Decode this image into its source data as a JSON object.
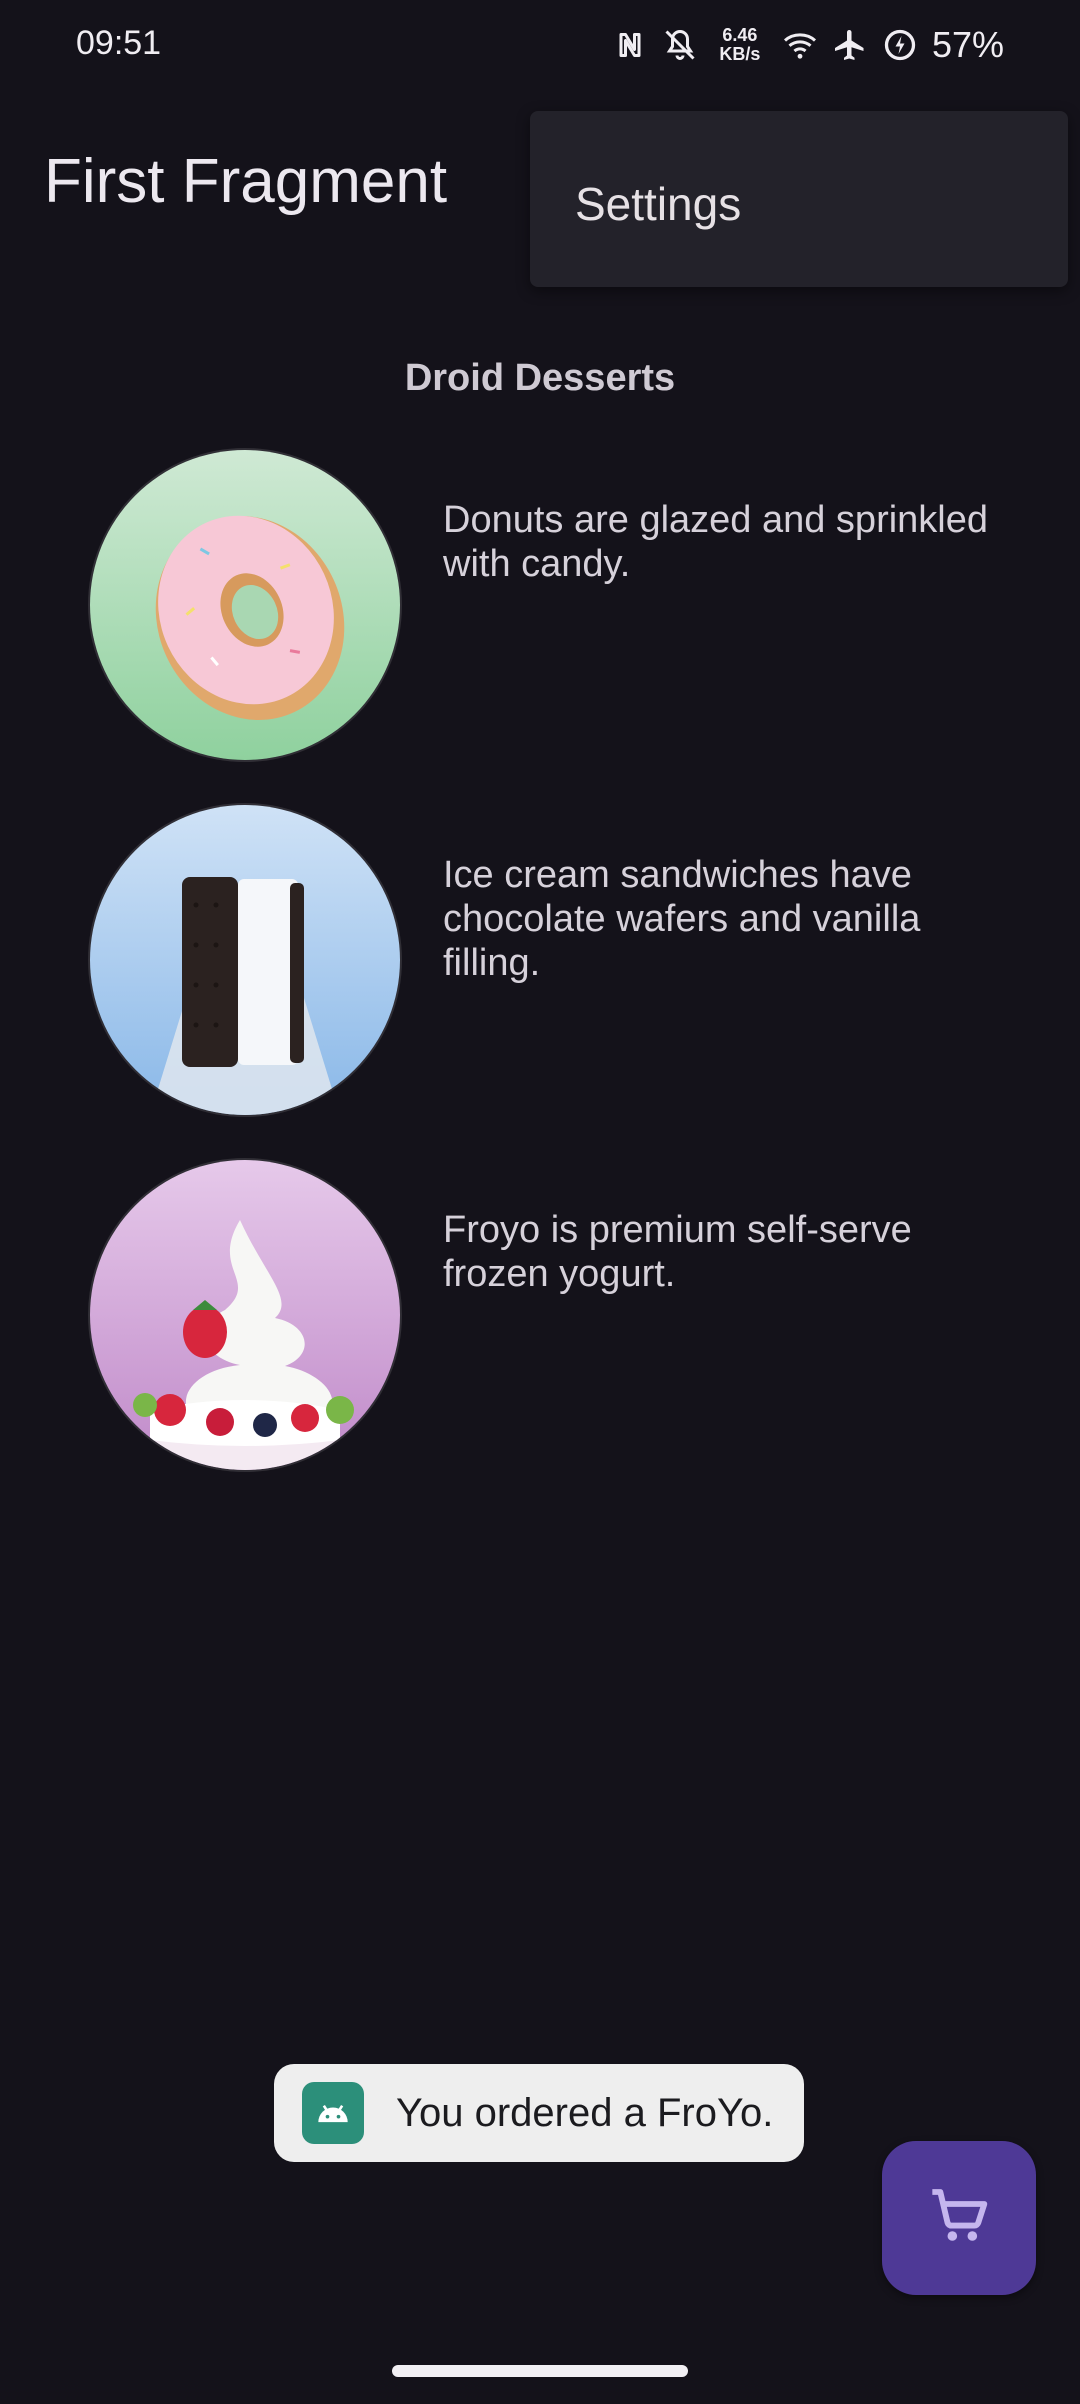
{
  "status_bar": {
    "time": "09:51",
    "net_speed_value": "6.46",
    "net_speed_unit": "KB/s",
    "battery_percent": "57%",
    "icons": [
      "nfc-icon",
      "bell-off-icon",
      "wifi-icon",
      "airplane-mode-icon",
      "battery-saver-icon"
    ]
  },
  "app_bar": {
    "title": "First Fragment"
  },
  "overflow_menu": {
    "items": [
      {
        "label": "Settings"
      }
    ]
  },
  "content": {
    "heading": "Droid Desserts",
    "desserts": [
      {
        "name": "donut",
        "description": "Donuts are glazed and sprinkled with candy."
      },
      {
        "name": "ice-cream-sandwich",
        "description": "Ice cream sandwiches have chocolate wafers and vanilla filling."
      },
      {
        "name": "froyo",
        "description": "Froyo is premium self-serve frozen yogurt."
      }
    ]
  },
  "toast": {
    "message": "You ordered a FroYo.",
    "icon": "android-icon"
  },
  "fab": {
    "icon": "shopping-cart-icon",
    "color": "#4e3996"
  },
  "colors": {
    "background": "#14121a",
    "menu_surface": "#23222a",
    "toast_background": "#eeeeee"
  }
}
